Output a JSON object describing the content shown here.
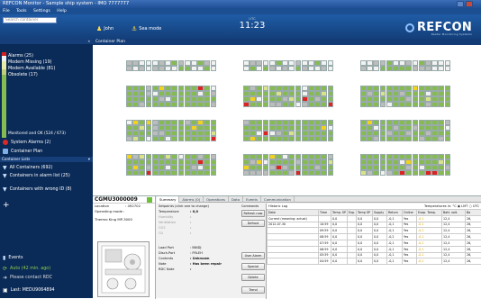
{
  "window": {
    "title": "REFCON Monitor - Sample ship system - IMO 7777777"
  },
  "menu": [
    "File",
    "Tools",
    "Settings",
    "Help"
  ],
  "header": {
    "search_placeholder": "Search container",
    "user": "John",
    "mode": "Sea mode",
    "time_label": "UTC",
    "time": "11:23",
    "brand": "REFCON",
    "brand_tag": "Reefer Monitoring Systems"
  },
  "sidebar": {
    "section1_title": "",
    "section1_chev": "«",
    "stats": [
      "Alarms (25)",
      "Modem Missing (19)",
      "Modem Available (81)",
      "Obsolete (17)"
    ],
    "stats_bottom": "Monitored and OK (524 / 673)",
    "system_alarms": "System Alarms (2)",
    "container_plan": "Container Plan",
    "lists_title": "Container Lists",
    "lists": [
      "All Containers (692)",
      "Containers in alarm list (25)",
      "Containers with wrong ID (8)"
    ],
    "plus": "+",
    "events": "Events",
    "auto": "Auto (42 min. ago)",
    "contact": "Please contact RDC",
    "last": "Last: MEDU9064894",
    "colors": {
      "alarm": "#d81e1e",
      "missing": "#e7e7ef",
      "available": "#d9e4a0",
      "obsolete": "#c7d78a",
      "ok": "#7ab648"
    }
  },
  "plan": {
    "title": "Container Plan"
  },
  "bottom": {
    "container_id": "CGMU3000009",
    "location_label": "Location",
    "location_value": ": 492702",
    "operating_mode_label": "Operating mode :",
    "unit": "Thermo King MP-3000",
    "tabs": [
      "Summary",
      "Alarms (0)",
      "Operations",
      "Data",
      "Events",
      "Communication"
    ],
    "setpoints_title": "Setpoints (click one to change)",
    "setpoints": [
      {
        "k": "Temperature",
        "v": ": 0,0"
      },
      {
        "k": "Humidity",
        "v": ":"
      },
      {
        "k": "Ventilation",
        "v": ":"
      },
      {
        "k": "CO2",
        "v": ":"
      },
      {
        "k": "O2",
        "v": ":"
      }
    ],
    "ports": [
      {
        "k": "Load Port",
        "v": ": BNIDJ"
      },
      {
        "k": "Disch.Port",
        "v": ": FRLEH"
      },
      {
        "k": "Contents",
        "v": ": Unknown"
      },
      {
        "k": "Note",
        "v": ": Has been repair"
      },
      {
        "k": "RDC Note",
        "v": ":"
      }
    ],
    "commands_title": "Commands",
    "commands": [
      "Refresh now",
      "Defrost",
      "User Alarm",
      "Special",
      "Delete",
      "Trend"
    ],
    "history_title": "Historic Log",
    "history_right": "Temperatures in:  °C   ◉ LMT  ○ UTC",
    "history_cols": [
      "Date",
      "Time",
      "Temp. SP",
      "Exp.",
      "Temp SP",
      "Supply",
      "Return",
      "Online",
      "Evap. Temp.",
      "Batt. volt.",
      "Ba"
    ],
    "history_rows": [
      [
        "Current (meaning: actual)",
        "",
        "0,0",
        "",
        "0,0",
        "0,0",
        "-0,1",
        "Yes",
        "-0,1",
        "12,4",
        "26,"
      ],
      [
        "2012-07-30",
        "10:59",
        "0,0",
        "",
        "0,0",
        "0,0",
        "-0,1",
        "Yes",
        "-0,1",
        "12,4",
        "26,"
      ],
      [
        "",
        "09:59",
        "0,0",
        "",
        "0,0",
        "0,0",
        "-0,1",
        "Yes",
        "-0,1",
        "12,4",
        "26,"
      ],
      [
        "",
        "08:59",
        "0,0",
        "",
        "0,0",
        "0,0",
        "-0,2",
        "Yes",
        "-0,1",
        "12,4",
        "26,"
      ],
      [
        "",
        "07:59",
        "0,0",
        "",
        "0,0",
        "0,0",
        "-0,1",
        "Yes",
        "-0,1",
        "12,4",
        "26,"
      ],
      [
        "",
        "06:59",
        "0,0",
        "",
        "0,0",
        "0,0",
        "-0,1",
        "Yes",
        "-0,1",
        "12,4",
        "26,"
      ],
      [
        "",
        "05:59",
        "0,0",
        "",
        "0,0",
        "0,0",
        "-0,1",
        "Yes",
        "-0,1",
        "12,4",
        "26,"
      ],
      [
        "",
        "04:59",
        "0,0",
        "",
        "0,0",
        "0,0",
        "-0,1",
        "Yes",
        "-0,1",
        "12,4",
        "26,"
      ]
    ]
  }
}
